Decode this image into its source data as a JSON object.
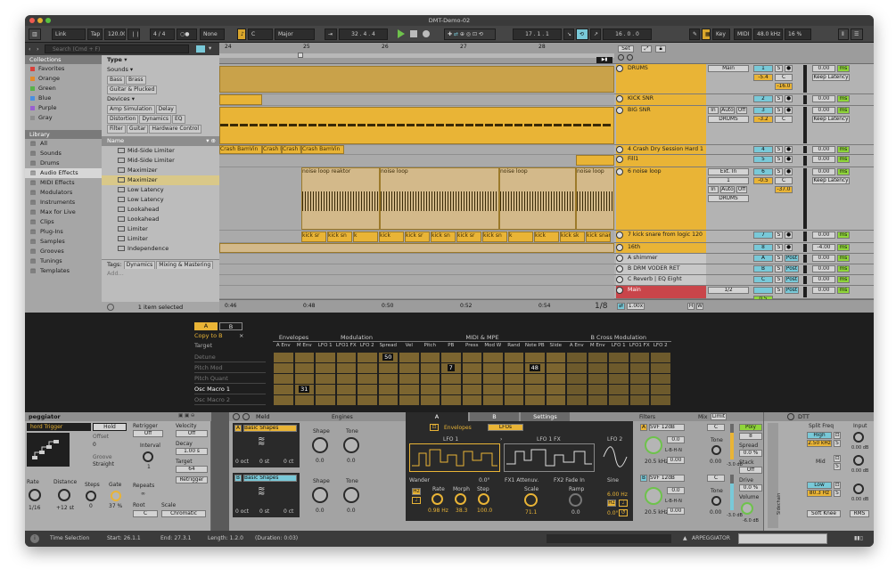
{
  "window": {
    "title": "DMT-Demo-02"
  },
  "control_bar": {
    "link": "Link",
    "tap": "Tap",
    "tempo": "120.00",
    "signature": "4 / 4",
    "quantize": "None",
    "key": "C",
    "scale": "Major",
    "position": "32 . 4 . 4",
    "loop_start": "17 . 1 . 1",
    "loop_length": "16 . 0 . 0",
    "key_btn": "Key",
    "midi_btn": "MIDI",
    "sample_rate": "48.0 kHz",
    "cpu": "16 %"
  },
  "browser": {
    "search_placeholder": "Search (Cmd + F)",
    "collections_header": "Collections",
    "collections": [
      {
        "label": "Favorites",
        "color": "#d9413a"
      },
      {
        "label": "Orange",
        "color": "#e28a2a"
      },
      {
        "label": "Green",
        "color": "#58b348"
      },
      {
        "label": "Blue",
        "color": "#4a8fe0"
      },
      {
        "label": "Purple",
        "color": "#9a5fd0"
      },
      {
        "label": "Gray",
        "color": "#8e8e8e"
      }
    ],
    "type_header": "Type",
    "sounds_header": "Sounds",
    "sounds_tags": [
      "Bass",
      "Brass",
      "Guitar & Plucked"
    ],
    "devices_header": "Devices",
    "devices_tags": [
      [
        "Amp Simulation",
        "Delay"
      ],
      [
        "Distortion",
        "Dynamics",
        "EQ"
      ],
      [
        "Filter",
        "Guitar",
        "Hardware Control"
      ]
    ],
    "library_header": "Library",
    "library": [
      {
        "label": "All",
        "icon": "grid-icon"
      },
      {
        "label": "Sounds",
        "icon": "wave-icon"
      },
      {
        "label": "Drums",
        "icon": "drums-icon"
      },
      {
        "label": "Audio Effects",
        "icon": "audio-fx-icon"
      },
      {
        "label": "MIDI Effects",
        "icon": "midi-fx-icon"
      },
      {
        "label": "Modulators",
        "icon": "modulator-icon"
      },
      {
        "label": "Instruments",
        "icon": "instrument-icon"
      },
      {
        "label": "Max for Live",
        "icon": "max-icon"
      },
      {
        "label": "Clips",
        "icon": "clip-icon"
      },
      {
        "label": "Plug-Ins",
        "icon": "plugin-icon"
      },
      {
        "label": "Samples",
        "icon": "sample-icon"
      },
      {
        "label": "Grooves",
        "icon": "groove-icon"
      },
      {
        "label": "Tunings",
        "icon": "tuning-icon"
      },
      {
        "label": "Templates",
        "icon": "template-icon"
      }
    ],
    "name_header": "Name",
    "items": [
      "Mid-Side Limiter",
      "Mid-Side Limiter",
      "Maximizer",
      "Maximizer",
      "Low Latency",
      "Low Latency",
      "Lookahead",
      "Lookahead",
      "Limiter",
      "Limiter",
      "Independence"
    ],
    "tags_label": "Tags:",
    "tags": [
      "Dynamics",
      "Mixing & Mastering"
    ],
    "add_label": "Add...",
    "footer": "1 item selected"
  },
  "arrangement": {
    "bars": [
      "24",
      "25",
      "26",
      "27",
      "28"
    ],
    "times": [
      "0:46",
      "0:48",
      "0:50",
      "0:52",
      "0:54"
    ],
    "fraction": "1/8",
    "clip_labels": {
      "crash": [
        "Crash BamVin",
        "Crash E",
        "Crash E",
        "Crash BamVin"
      ],
      "noise": [
        "noise loop reaktor",
        "noise loop",
        "noise loop",
        "noise loop"
      ],
      "kick": [
        "kick sr",
        "kick sn",
        "k",
        "kick",
        "kick sr",
        "kick sn",
        "kick sr",
        "kick sn",
        "k",
        "kick",
        "kick sk",
        "kick snare fr"
      ]
    }
  },
  "mixer": {
    "set_label": "Set",
    "zoom": "1.00x",
    "tracks": [
      {
        "name": "DRUMS",
        "type": "group",
        "io": "Main",
        "vol": "-5.4",
        "pan": "C",
        "send": "-16.0",
        "num": "1",
        "delay": "0.00",
        "unit": "ms",
        "extra": "Keep Latency"
      },
      {
        "name": "KICK SNR",
        "type": "audio",
        "num": "2",
        "delay": "0.00",
        "unit": "ms"
      },
      {
        "name": "BIG SNR",
        "type": "audio",
        "in": "In",
        "auto": "Auto",
        "off": "Off",
        "route": "DRUMS",
        "vol": "-3.2",
        "pan": "C",
        "num": "3",
        "delay": "0.00",
        "unit": "ms",
        "extra": "Keep Latency"
      },
      {
        "name": "4 Crash Dry Session Hard 1",
        "type": "audio",
        "num": "4",
        "delay": "0.00",
        "unit": "ms"
      },
      {
        "name": "Fill1",
        "type": "audio",
        "num": "5",
        "delay": "0.00",
        "unit": "ms"
      },
      {
        "name": "6 noise loop",
        "type": "audio",
        "io": "Ext. In",
        "io2": "1",
        "in": "In",
        "auto": "Auto",
        "off": "Off",
        "route": "DRUMS",
        "vol": "-0.5",
        "pan": "C",
        "send": "-37.0",
        "num": "6",
        "delay": "0.00",
        "unit": "ms",
        "extra": "Keep Latency"
      },
      {
        "name": "7 kick snare from logic 120",
        "type": "audio",
        "num": "7",
        "delay": "0.00",
        "unit": "ms"
      },
      {
        "name": "16th",
        "type": "audio",
        "num": "8",
        "delay": "-4.00",
        "unit": "ms"
      },
      {
        "name": "A shimmer",
        "type": "return",
        "num": "A",
        "post": "Post",
        "delay": "0.00",
        "unit": "ms"
      },
      {
        "name": "B DRM VODER RET",
        "type": "return",
        "num": "B",
        "post": "Post",
        "delay": "0.00",
        "unit": "ms"
      },
      {
        "name": "C Reverb | EQ Eight",
        "type": "return",
        "num": "C",
        "post": "Post",
        "delay": "0.00",
        "unit": "ms"
      },
      {
        "name": "D UADx Lexicon 224 Digital R",
        "type": "return",
        "num": "D",
        "post": "Post",
        "delay": "0.00",
        "unit": "ms"
      },
      {
        "name": "Main",
        "type": "main",
        "io": "1/2",
        "vol": "0.5",
        "delay": "0.00",
        "unit": "ms"
      }
    ]
  },
  "modmatrix": {
    "tabs": [
      "A",
      "B"
    ],
    "copy": "Copy to B",
    "close": "×",
    "target_label": "Target",
    "groups": [
      "Envelopes",
      "Modulation",
      "MIDI & MPE",
      "B Cross Modulation"
    ],
    "columns": [
      "A Env",
      "M Env",
      "LFO 1",
      "LFO1 FX",
      "LFO 2",
      "Spread",
      "Vel",
      "Pitch",
      "PB",
      "Press",
      "Mod W",
      "Rand",
      "Note PB",
      "Slide",
      "A Env",
      "M Env",
      "LFO 1",
      "LFO1 FX",
      "LFO 2"
    ],
    "targets": [
      "Detune",
      "Pitch Mod",
      "Pitch Quant",
      "Osc Macro 1",
      "Osc Macro 2"
    ],
    "values": [
      {
        "target": 3,
        "col": 1,
        "value": "31"
      },
      {
        "target": 0,
        "col": 5,
        "value": "50"
      },
      {
        "target": 1,
        "col": 8,
        "value": "7"
      },
      {
        "target": 1,
        "col": 12,
        "value": "48"
      }
    ]
  },
  "devices": {
    "arp": {
      "title": "peggiator",
      "mode": "hord Trigger",
      "hold": "Hold",
      "offset_label": "Offset",
      "offset": "0",
      "groove_label": "Groove",
      "groove": "Straight",
      "retrigger_label": "Retrigger",
      "retrigger": "Off",
      "interval_label": "Interval",
      "interval": "1",
      "repeats_label": "Repeats",
      "repeats": "∞",
      "root_label": "Root",
      "root": "C",
      "scale_label": "Scale",
      "scale": "Chromatic",
      "velocity_label": "Velocity",
      "velocity": "Off",
      "decay_label": "Decay",
      "decay": "1.00 s",
      "target_label": "Target",
      "target": "64",
      "retrig_btn": "Retrigger",
      "rate_label": "Rate",
      "rate": "1/16",
      "distance_label": "Distance",
      "distance": "+12 st",
      "steps_label": "Steps",
      "steps": "0",
      "gate_label": "Gate",
      "gate": "37 %"
    },
    "meld": {
      "title": "Meld",
      "engines_label": "Engines",
      "tab_a": "A",
      "tab_b": "B",
      "tab_settings": "Settings",
      "osc_a": "Basic Shapes",
      "osc_b": "Basic Shapes",
      "shape_label": "Shape",
      "tone_label": "Tone",
      "shape_a": "0.0",
      "tone_a": "0.0",
      "shape_b": "0.0",
      "tone_b": "0.0",
      "oct_a": [
        "0 oct",
        "0 st",
        "0 ct"
      ],
      "oct_b": [
        "0 oct",
        "0 st",
        "0 ct"
      ],
      "env_tab": "Envelopes",
      "lfo_tab": "LFOs",
      "lfo1": "LFO 1",
      "lfo1fx": "LFO 1 FX",
      "lfo2": "LFO 2",
      "wander": "Wander",
      "wander_val": "0.0°",
      "rate_label": "Rate",
      "morph_label": "Morph",
      "step_label": "Step",
      "rate": "0.98 Hz",
      "morph": "38.3",
      "step": "100.0",
      "fx1": "FX1 Attenuv.",
      "fx2": "FX2 Fade In",
      "scale_label": "Scale",
      "ramp_label": "Ramp",
      "scale": "71.1",
      "ramp": "0.0",
      "sine": "Sine",
      "lfo2_rate": "6.00 Hz",
      "lfo2_phase": "0.0°",
      "hz": "Hz",
      "filters_label": "Filters",
      "mix_label": "Mix",
      "limit": "Limit",
      "filt_a": "SVF 12dB",
      "filt_b": "SVF 12dB",
      "freq_a": "20.5 kHz",
      "freq_b": "20.5 kHz",
      "res_a": "0.0",
      "res_b": "0.0",
      "mode": "L-B-H-N",
      "filt_val": "0.00",
      "pan": "C",
      "tone_label2": "Tone",
      "tone_val": "0.00",
      "db": "-3.0 dB",
      "poly": "Poly",
      "voices": "8",
      "spread_label": "Spread",
      "spread": "0.0 %",
      "stack_label": "Stack",
      "stack": "Off",
      "drive_label": "Drive",
      "drive": "0.0 %",
      "volume_label": "Volume",
      "volume": "-6.0 dB"
    },
    "dtt": {
      "title": "DTT",
      "split_label": "Split Freq",
      "input_label": "Input",
      "high": "High",
      "freq": "2.50 kHz",
      "s": "S",
      "mid": "Mid",
      "low": "Low",
      "low_freq": "80.3 Hz",
      "db1": "0.00 dB",
      "db2": "0.00 dB",
      "db3": "0.00 dB",
      "soft_knee": "Soft Knee",
      "rms": "RMS",
      "sidechain": "Sidechain"
    }
  },
  "status": {
    "selection": "Time Selection",
    "start": "Start: 26.1.1",
    "end": "End: 27.3.1",
    "length": "Length: 1.2.0",
    "duration": "(Duration: 0:03)",
    "arp": "ARPEGGIATOR"
  },
  "colors": {
    "accent": "#e9b436",
    "selected": "#ffc943",
    "main_track": "#c9454a",
    "teal": "#79c9d8",
    "green": "#8fd53a"
  }
}
